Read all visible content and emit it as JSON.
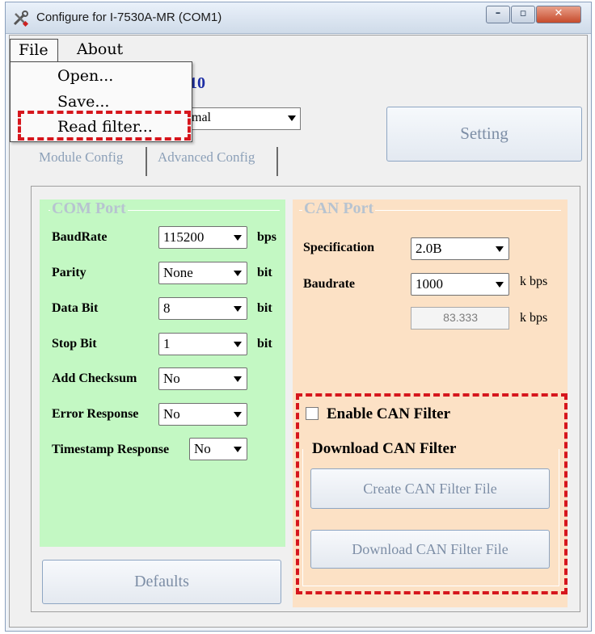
{
  "window": {
    "title": "Configure for I-7530A-MR (COM1)",
    "controls": {
      "minimize": "–",
      "maximize": "▫",
      "close": "✕"
    }
  },
  "menu": {
    "file": "File",
    "about": "About",
    "file_items": [
      "Open...",
      "Save...",
      "Read filter..."
    ],
    "highlighted_item": "Read filter..."
  },
  "header": {
    "version_partial": "10",
    "mode_combo_partial": "mal"
  },
  "setting_button": "Setting",
  "tabs": [
    "Module Config",
    "Advanced Config"
  ],
  "com_port": {
    "title": "COM Port",
    "fields": [
      {
        "label": "BaudRate",
        "value": "115200",
        "unit": "bps"
      },
      {
        "label": "Parity",
        "value": "None",
        "unit": "bit"
      },
      {
        "label": "Data Bit",
        "value": "8",
        "unit": "bit"
      },
      {
        "label": "Stop Bit",
        "value": "1",
        "unit": "bit"
      },
      {
        "label": "Add Checksum",
        "value": "No",
        "unit": ""
      },
      {
        "label": "Error Response",
        "value": "No",
        "unit": ""
      },
      {
        "label": "Timestamp Response",
        "value": "No",
        "unit": ""
      }
    ],
    "defaults_button": "Defaults"
  },
  "can_port": {
    "title": "CAN Port",
    "specification": {
      "label": "Specification",
      "value": "2.0B"
    },
    "baudrate": {
      "label": "Baudrate",
      "value": "1000",
      "unit": "k bps"
    },
    "actual_rate": {
      "value": "83.333",
      "unit": "k bps"
    },
    "enable_filter": {
      "label": "Enable CAN Filter",
      "checked": false
    },
    "download_group_title": "Download CAN Filter",
    "create_button": "Create CAN Filter File",
    "download_button": "Download CAN Filter File"
  },
  "colors": {
    "com_bg": "#c3f8c3",
    "can_bg": "#fce1c5",
    "highlight": "#d6161d",
    "version_blue": "#1e2fa5"
  }
}
